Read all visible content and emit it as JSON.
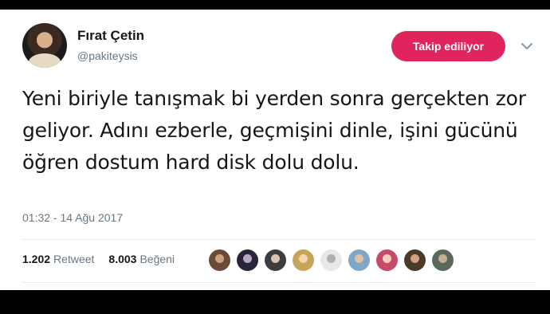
{
  "user": {
    "name": "Fırat Çetin",
    "handle": "@pakiteysis"
  },
  "follow_button_label": "Takip ediliyor",
  "tweet": {
    "text": "Yeni biriyle tanışmak bi yerden sonra gerçekten zor geliyor. Adını ezberle, geçmişini dinle, işini gücünü öğren dostum hard disk dolu dolu.",
    "timestamp": "01:32 - 14 Ağu 2017"
  },
  "stats": {
    "retweet_count": "1.202",
    "retweet_label": "Retweet",
    "like_count": "8.003",
    "like_label": "Beğeni"
  },
  "likers": [
    {
      "colors": [
        "#6b4a3a",
        "#c9a27e"
      ]
    },
    {
      "colors": [
        "#2a2438",
        "#b9a7c8"
      ]
    },
    {
      "colors": [
        "#3d3d3d",
        "#d8c4b0"
      ]
    },
    {
      "colors": [
        "#c8a45a",
        "#f0d6a8"
      ]
    },
    {
      "colors": [
        "#e8e8e8",
        "#b0b0b0"
      ]
    },
    {
      "colors": [
        "#7fa8c8",
        "#e0c0a0"
      ]
    },
    {
      "colors": [
        "#c84a6a",
        "#f3d0c0"
      ]
    },
    {
      "colors": [
        "#4a3a2a",
        "#d0a080"
      ]
    },
    {
      "colors": [
        "#5a6a5a",
        "#c0b090"
      ]
    }
  ],
  "colors": {
    "accent": "#e0245e",
    "muted": "#657786",
    "text": "#14171a"
  }
}
